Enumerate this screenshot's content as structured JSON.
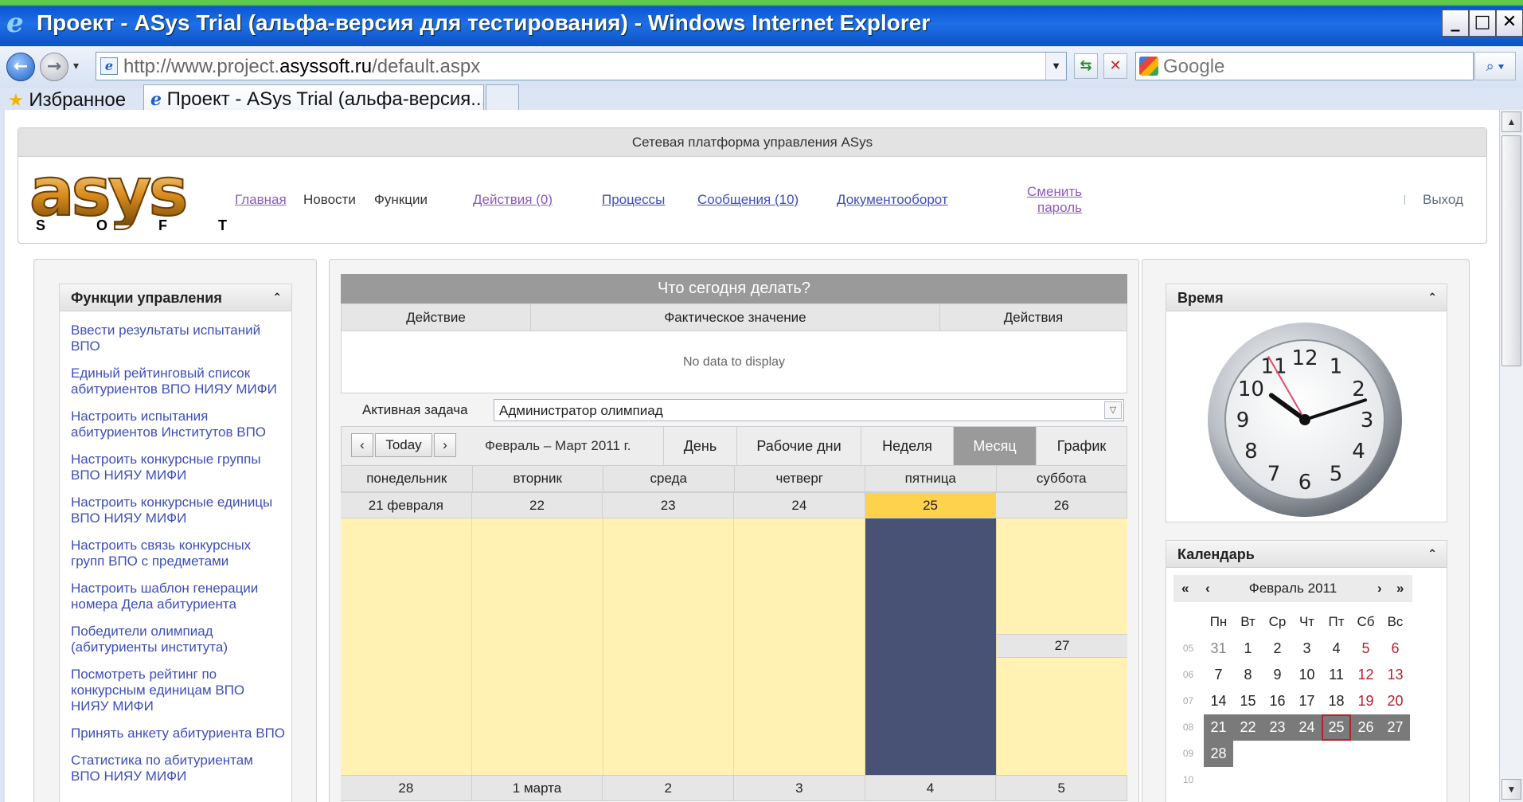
{
  "window": {
    "title": "Проект - ASys Trial (альфа-версия для тестирования) - Windows Internet Explorer",
    "min": "_",
    "max": "□",
    "close": "✕"
  },
  "addressbar": {
    "url_prefix": "http://www.project.",
    "url_domain": "asyssoft.ru",
    "url_suffix": "/default.aspx",
    "search_placeholder": "Google"
  },
  "favorites": {
    "label": "Избранное"
  },
  "tab": {
    "title": "Проект - ASys Trial (альфа-версия..."
  },
  "site": {
    "strip": "Сетевая платформа управления ASys",
    "logo_word": "asys",
    "logo_soft": [
      "S",
      "O",
      "F",
      "T"
    ],
    "nav": {
      "home": "Главная",
      "news": "Новости",
      "functions": "Функции",
      "actions": "Действия (0)",
      "processes": "Процессы",
      "messages": "Сообщения (10)",
      "docflow": "Документооборот",
      "change_pw_1": "Сменить",
      "change_pw_2": "пароль",
      "logout": "Выход"
    }
  },
  "left": {
    "title": "Функции управления",
    "items": [
      "Ввести результаты испытаний ВПО",
      "Единый рейтинговый список абитуриентов ВПО НИЯУ МИФИ",
      "Настроить испытания абитуриентов Институтов ВПО",
      "Настроить конкурсные группы ВПО НИЯУ МИФИ",
      "Настроить конкурсные единицы ВПО НИЯУ МИФИ",
      "Настроить связь конкурсных групп ВПО с предметами",
      "Настроить шаблон генерации номера Дела абитуриента",
      "Победители олимпиад (абитуриенты института)",
      "Посмотреть рейтинг по конкурсным единицам ВПО НИЯУ МИФИ",
      "Принять анкету абитуриента ВПО",
      "Статистика по абитуриентам ВПО НИЯУ МИФИ"
    ]
  },
  "todo": {
    "title": "Что сегодня делать?",
    "columns": [
      "Действие",
      "Фактическое значение",
      "Действия"
    ],
    "empty": "No data to display"
  },
  "task": {
    "label": "Активная задача",
    "value": "Администратор олимпиад"
  },
  "scheduler": {
    "today": "Today",
    "range": "Февраль – Март 2011 г.",
    "views": [
      "День",
      "Рабочие дни",
      "Неделя",
      "Месяц",
      "График"
    ],
    "active_view": "Месяц",
    "weekdays": [
      "понедельник",
      "вторник",
      "среда",
      "четверг",
      "пятница",
      "суббота"
    ],
    "week1": [
      "21 февраля",
      "22",
      "23",
      "24",
      "25",
      "26"
    ],
    "sunday1": "27",
    "week2": [
      "28",
      "1 марта",
      "2",
      "3",
      "4",
      "5"
    ],
    "today_index": 4
  },
  "right": {
    "time_title": "Время",
    "calendar_title": "Календарь",
    "clock": {
      "hour": 10,
      "minute": 12,
      "second": 55
    },
    "month_label": "Февраль 2011",
    "nav": {
      "prev_year": "«",
      "prev": "‹",
      "next": "›",
      "next_year": "»"
    },
    "dow": [
      "Пн",
      "Вт",
      "Ср",
      "Чт",
      "Пт",
      "Сб",
      "Вс"
    ],
    "weeks": [
      {
        "wk": "05",
        "days": [
          "31",
          "1",
          "2",
          "3",
          "4",
          "5",
          "6"
        ]
      },
      {
        "wk": "06",
        "days": [
          "7",
          "8",
          "9",
          "10",
          "11",
          "12",
          "13"
        ]
      },
      {
        "wk": "07",
        "days": [
          "14",
          "15",
          "16",
          "17",
          "18",
          "19",
          "20"
        ]
      },
      {
        "wk": "08",
        "days": [
          "21",
          "22",
          "23",
          "24",
          "25",
          "26",
          "27"
        ]
      },
      {
        "wk": "09",
        "days": [
          "28",
          "",
          "",
          "",
          "",
          "",
          ""
        ]
      },
      {
        "wk": "10",
        "days": [
          "",
          "",
          "",
          "",
          "",
          "",
          ""
        ]
      }
    ],
    "today": "25"
  },
  "colors": {
    "today_cell": "#ffd24d",
    "today_column": "#475275",
    "appointment_bg": "#fff2b2",
    "link": "#3d4eb8"
  }
}
